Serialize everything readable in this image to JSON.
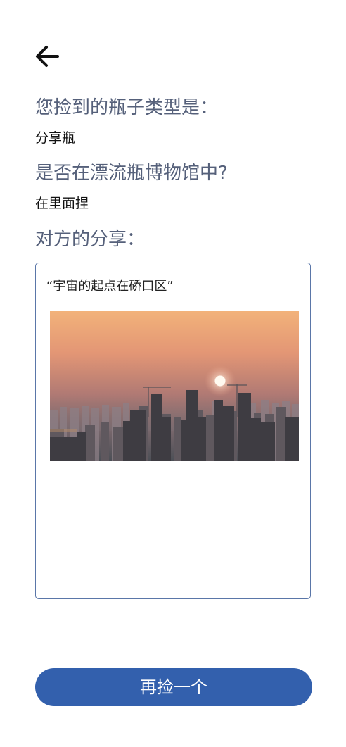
{
  "header": {
    "back_icon": "arrow-left-icon"
  },
  "bottle_type": {
    "question": "您捡到的瓶子类型是：",
    "answer": "分享瓶"
  },
  "museum": {
    "question": "是否在漂流瓶博物馆中?",
    "answer": "在里面捏"
  },
  "share": {
    "heading": "对方的分享：",
    "text": "“宇宙的起点在硚口区”",
    "photo_subject": "sunset-city-skyline-photo"
  },
  "actions": {
    "pick_again_label": "再捡一个"
  },
  "colors": {
    "accent": "#3360ad",
    "label": "#55607a",
    "border": "#5a76a8"
  }
}
